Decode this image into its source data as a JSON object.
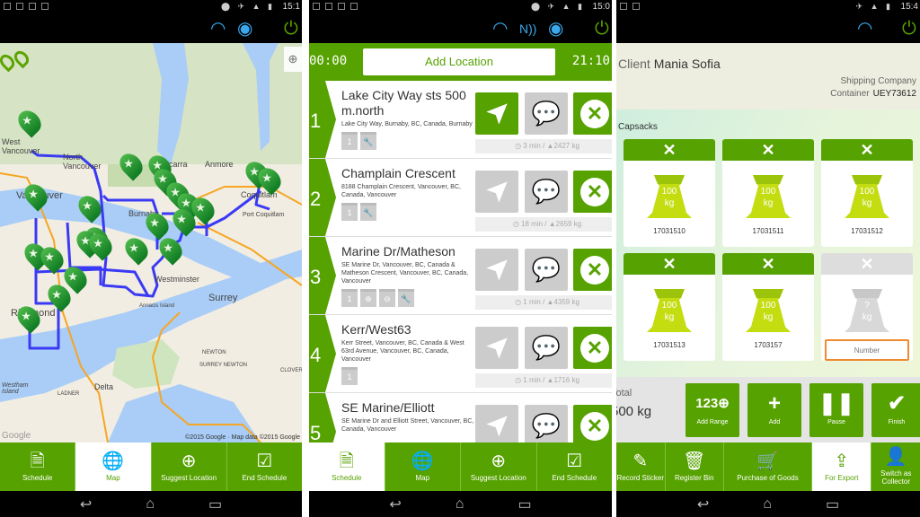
{
  "colors": {
    "brand_green": "#56a200",
    "wifi_blue": "#3aa8ee",
    "route_blue": "#3a3af5",
    "input_orange": "#f08a30"
  },
  "screens": [
    {
      "status_time": "15:1",
      "map": {
        "labels": [
          "West Vancouver",
          "North Vancouver",
          "Belcarra",
          "Anmore",
          "Vancouver",
          "Burnaby",
          "Coquitlam",
          "Port Coquitlam",
          "Richmond",
          "New Westminster",
          "Annacis Island",
          "Surrey",
          "Newton",
          "Surrey Newton",
          "Cloverdale",
          "Delta",
          "Ladner",
          "Westham Island"
        ],
        "attribution": "©2015 Google · Map data ©2015 Google",
        "google_logo": "Google",
        "my_location_icon": "crosshair-icon"
      },
      "nav": [
        {
          "label": "Schedule",
          "icon": "document-icon"
        },
        {
          "label": "Map",
          "icon": "globe-icon",
          "active": true
        },
        {
          "label": "Suggest Location",
          "icon": "pin-plus-icon"
        },
        {
          "label": "End Schedule",
          "icon": "document-check-icon"
        }
      ]
    },
    {
      "status_time": "15:0",
      "header": {
        "left_timer": "00:00",
        "add_location": "Add Location",
        "right_timer": "21:10"
      },
      "rows": [
        {
          "num": "1",
          "title": "Lake City Way sts 500 m.north",
          "address": "Lake City Way, Burnaby, BC, Canada, Burnaby",
          "bins": [
            "1",
            "🔧"
          ],
          "time": "3 min",
          "weight": "2427 kg",
          "nav_active": true
        },
        {
          "num": "2",
          "title": "Champlain Crescent",
          "address": "8188 Champlain Crescent, Vancouver, BC, Canada, Vancouver",
          "bins": [
            "1",
            "🔧"
          ],
          "time": "18 min",
          "weight": "2659 kg"
        },
        {
          "num": "3",
          "title": "Marine Dr/Matheson",
          "address": "SE Marine Dr, Vancouver, BC, Canada & Matheson Crescent, Vancouver, BC, Canada, Vancouver",
          "bins": [
            "1",
            "⊕",
            "⊖",
            "🔧"
          ],
          "time": "1 min",
          "weight": "4359 kg"
        },
        {
          "num": "4",
          "title": "Kerr/West63",
          "address": "Kerr Street, Vancouver, BC, Canada & West 63rd Avenue, Vancouver, BC, Canada, Vancouver",
          "bins": [
            "1"
          ],
          "time": "1 min",
          "weight": "1716 kg"
        },
        {
          "num": "5",
          "title": "SE Marine/Elliott",
          "address": "SE Marine Dr and Elliott Street, Vancouver, BC, Canada, Vancouver",
          "bins": [],
          "time": "",
          "weight": ""
        }
      ],
      "nav": [
        {
          "label": "Schedule",
          "icon": "document-icon",
          "active": true
        },
        {
          "label": "Map",
          "icon": "globe-icon"
        },
        {
          "label": "Suggest Location",
          "icon": "pin-plus-icon"
        },
        {
          "label": "End Schedule",
          "icon": "document-check-icon"
        }
      ]
    },
    {
      "status_time": "15:4",
      "client_label": "Client",
      "client_name": "Mania Sofia",
      "shipping_company_label": "Shipping Company",
      "container_label": "Container",
      "container_value": "UEY73612",
      "capsacks_label": "Capsacks",
      "cards": [
        {
          "weight": "100",
          "unit": "kg",
          "number": "17031510"
        },
        {
          "weight": "100",
          "unit": "kg",
          "number": "17031511"
        },
        {
          "weight": "100",
          "unit": "kg",
          "number": "17031512"
        },
        {
          "weight": "100",
          "unit": "kg",
          "number": "17031513"
        },
        {
          "weight": "100",
          "unit": "kg",
          "number": "1703157"
        },
        {
          "weight": "?",
          "unit": "kg",
          "placeholder": "Number",
          "empty": true
        }
      ],
      "total_label": "Total",
      "total_value": "500 kg",
      "actions": [
        {
          "label": "Add Range",
          "glyph": "123⊕"
        },
        {
          "label": "Add",
          "glyph": "+"
        },
        {
          "label": "Pause",
          "glyph": "❚❚"
        },
        {
          "label": "Finish",
          "glyph": "✔"
        }
      ],
      "nav": [
        {
          "label": "Record Sticker",
          "icon": "pen-icon"
        },
        {
          "label": "Register Bin",
          "icon": "trash-icon"
        },
        {
          "label": "Purchase of Goods",
          "icon": "cart-icon"
        },
        {
          "label": "For Export",
          "icon": "export-icon",
          "active": true
        },
        {
          "label": "Switch as Collector",
          "icon": "person-icon"
        }
      ]
    }
  ]
}
